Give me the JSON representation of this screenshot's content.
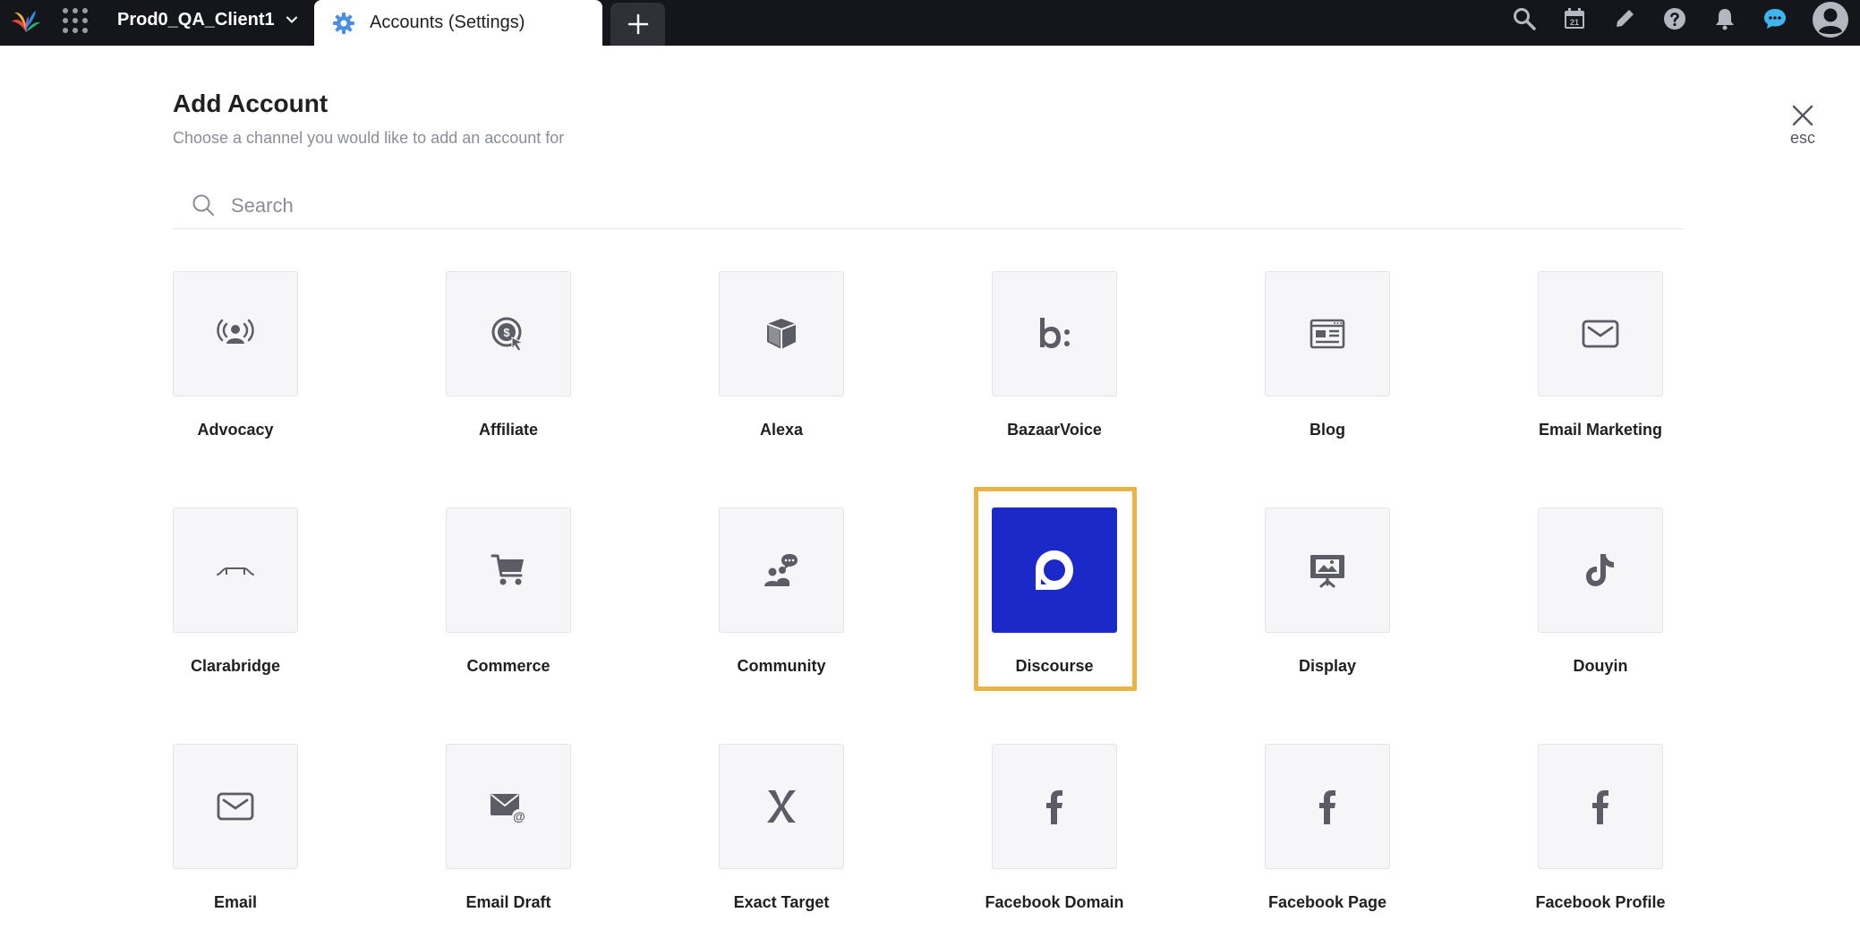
{
  "topbar": {
    "workspace_name": "Prod0_QA_Client1",
    "active_tab_label": "Accounts (Settings)",
    "icons": [
      "search-icon",
      "calendar-icon",
      "pencil-icon",
      "help-icon",
      "bell-icon",
      "chat-icon",
      "user-avatar-icon"
    ],
    "calendar_day": "21"
  },
  "header": {
    "title": "Add Account",
    "subtitle": "Choose a channel you would like to add an account for",
    "close_hint": "esc"
  },
  "search": {
    "placeholder": "Search",
    "value": ""
  },
  "channels": [
    {
      "label": "Advocacy",
      "icon": "advocacy-icon"
    },
    {
      "label": "Affiliate",
      "icon": "affiliate-icon"
    },
    {
      "label": "Alexa",
      "icon": "alexa-icon"
    },
    {
      "label": "BazaarVoice",
      "icon": "bazaarvoice-icon"
    },
    {
      "label": "Blog",
      "icon": "blog-icon"
    },
    {
      "label": "Email Marketing",
      "icon": "email-marketing-icon"
    },
    {
      "label": "Clarabridge",
      "icon": "clarabridge-icon"
    },
    {
      "label": "Commerce",
      "icon": "cart-icon"
    },
    {
      "label": "Community",
      "icon": "community-icon"
    },
    {
      "label": "Discourse",
      "icon": "discourse-icon",
      "selected": true
    },
    {
      "label": "Display",
      "icon": "display-icon"
    },
    {
      "label": "Douyin",
      "icon": "douyin-icon"
    },
    {
      "label": "Email",
      "icon": "email-icon"
    },
    {
      "label": "Email Draft",
      "icon": "email-draft-icon"
    },
    {
      "label": "Exact Target",
      "icon": "exact-target-icon"
    },
    {
      "label": "Facebook Domain",
      "icon": "facebook-icon"
    },
    {
      "label": "Facebook Page",
      "icon": "facebook-icon"
    },
    {
      "label": "Facebook Profile",
      "icon": "facebook-icon"
    }
  ],
  "colors": {
    "topbar_bg": "#15161c",
    "selected_tile": "#1c29c9",
    "highlight_border": "#e8b445",
    "icon_gray": "#5b5c66"
  }
}
